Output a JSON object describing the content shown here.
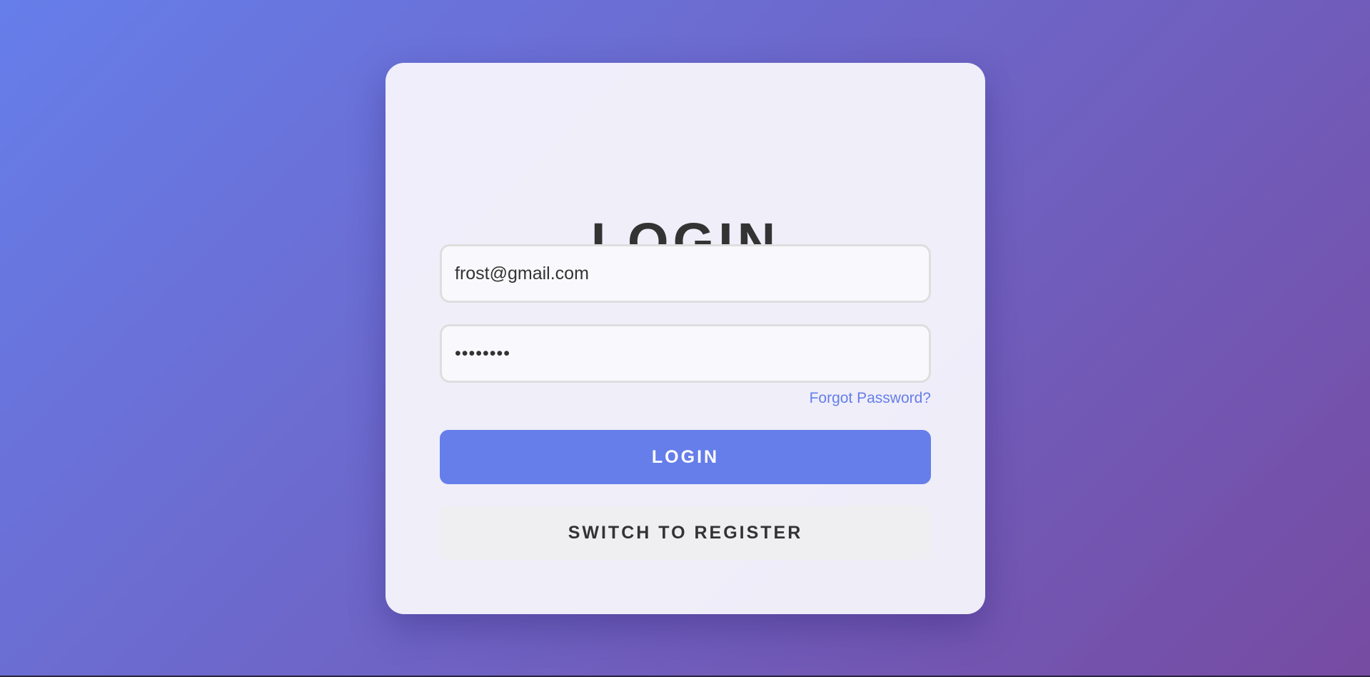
{
  "login_form": {
    "title": "LOGIN",
    "email_value": "frost@gmail.com",
    "password_value": "••••••••",
    "forgot_password_label": "Forgot Password?",
    "login_button_label": "LOGIN",
    "switch_button_label": "SWITCH TO REGISTER"
  },
  "colors": {
    "background_gradient_start": "#667eea",
    "background_gradient_end": "#764ba2",
    "accent": "#667eea",
    "title_text": "#333333",
    "secondary_button_bg": "#efeff1"
  }
}
